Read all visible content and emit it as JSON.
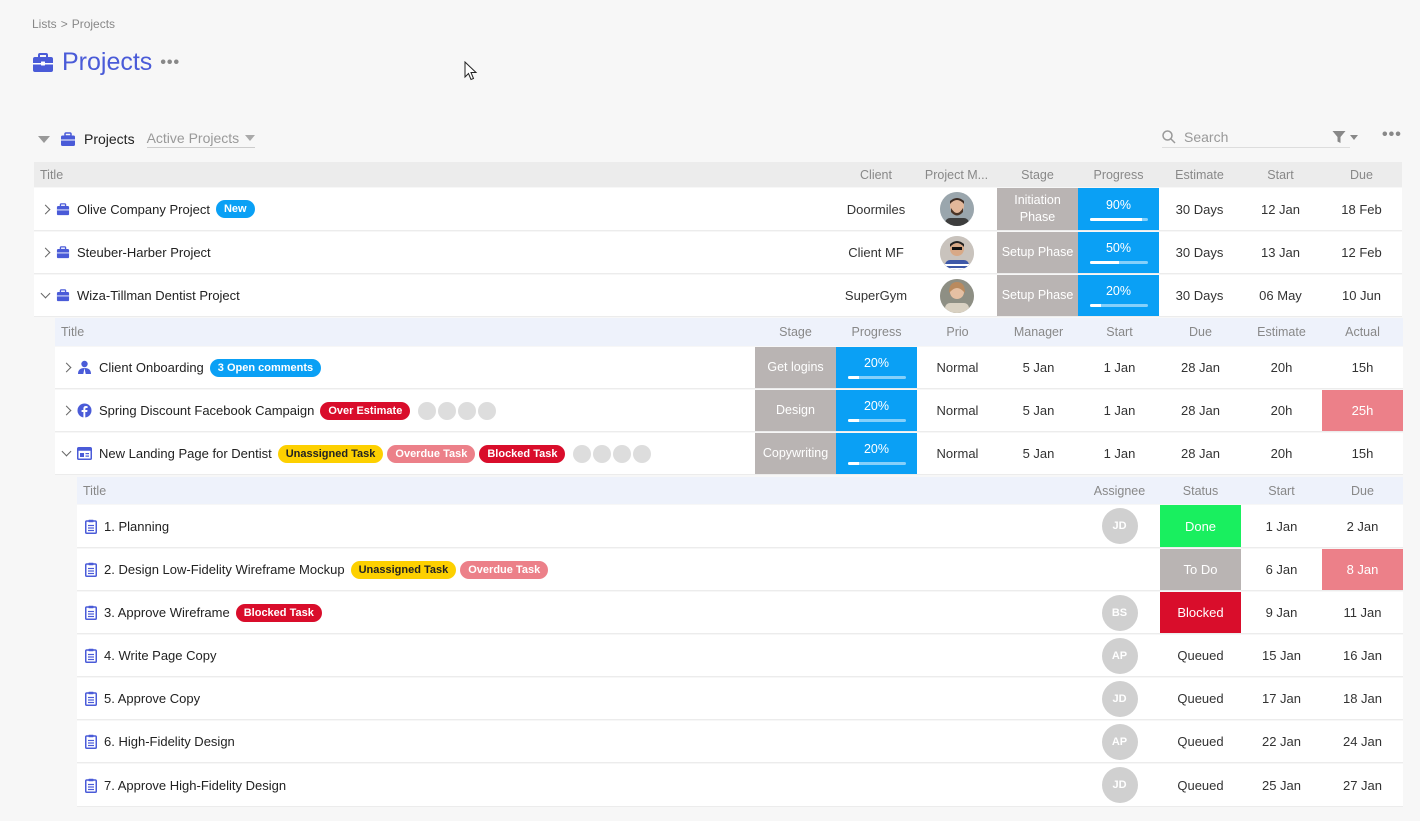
{
  "breadcrumb": {
    "lists": "Lists",
    "sep": ">",
    "current": "Projects"
  },
  "page": {
    "title": "Projects",
    "more": "•••"
  },
  "list": {
    "name": "Projects",
    "view": "Active Projects",
    "search_placeholder": "Search",
    "more": "•••"
  },
  "colors": {
    "accent": "#4a5bd8",
    "progress": "#0aa0f5",
    "stage": "#b9b4b3",
    "done": "#19ef5f",
    "blocked": "#d90d2b",
    "overdue": "#ec8089",
    "badge_new": "#0aa0f5",
    "badge_unassigned": "#fdd000",
    "badge_overdue": "#ec8089",
    "badge_blocked": "#d90d2b",
    "badge_over_estimate": "#d90d2b"
  },
  "icons": {
    "project": "briefcase-icon",
    "onboarding": "person-icon",
    "campaign": "facebook-icon",
    "landing": "window-icon",
    "task": "clipboard-icon",
    "search": "search-icon",
    "filter": "filter-icon"
  },
  "projects_header": {
    "title": "Title",
    "client": "Client",
    "manager": "Project M...",
    "stage": "Stage",
    "progress": "Progress",
    "estimate": "Estimate",
    "start": "Start",
    "due": "Due"
  },
  "projects": [
    {
      "title": "Olive Company Project",
      "badge": "New",
      "client": "Doormiles",
      "stage": "Initiation Phase",
      "progress": "90%",
      "progress_value": 90,
      "estimate": "30 Days",
      "start": "12 Jan",
      "due": "18 Feb"
    },
    {
      "title": "Steuber-Harber Project",
      "client": "Client MF",
      "stage": "Setup Phase",
      "progress": "50%",
      "progress_value": 50,
      "estimate": "30 Days",
      "start": "13 Jan",
      "due": "12 Feb"
    },
    {
      "title": "Wiza-Tillman Dentist Project",
      "client": "SuperGym",
      "stage": "Setup Phase",
      "progress": "20%",
      "progress_value": 20,
      "estimate": "30 Days",
      "start": "06 May",
      "due": "10 Jun"
    }
  ],
  "sub_header": {
    "title": "Title",
    "stage": "Stage",
    "progress": "Progress",
    "prio": "Prio",
    "manager": "Manager",
    "start": "Start",
    "due": "Due",
    "estimate": "Estimate",
    "actual": "Actual"
  },
  "sub_items": [
    {
      "title": "Client Onboarding",
      "badges": [
        "3 Open comments"
      ],
      "stage": "Get logins",
      "progress": "20%",
      "progress_value": 20,
      "prio": "Normal",
      "manager": "5 Jan",
      "start": "1 Jan",
      "due": "28 Jan",
      "estimate": "20h",
      "actual": "15h"
    },
    {
      "title": "Spring Discount Facebook Campaign",
      "badges": [
        "Over Estimate"
      ],
      "stage": "Design",
      "progress": "20%",
      "progress_value": 20,
      "prio": "Normal",
      "manager": "5 Jan",
      "start": "1 Jan",
      "due": "28 Jan",
      "estimate": "20h",
      "actual": "25h"
    },
    {
      "title": "New Landing Page for Dentist",
      "badges": [
        "Unassigned Task",
        "Overdue Task",
        "Blocked Task"
      ],
      "stage": "Copywriting",
      "progress": "20%",
      "progress_value": 20,
      "prio": "Normal",
      "manager": "5 Jan",
      "start": "1 Jan",
      "due": "28 Jan",
      "estimate": "20h",
      "actual": "15h"
    }
  ],
  "task_header": {
    "title": "Title",
    "assignee": "Assignee",
    "status": "Status",
    "start": "Start",
    "due": "Due"
  },
  "tasks": [
    {
      "title": "1. Planning",
      "badges": [],
      "assignee": "JD",
      "status": "Done",
      "start": "1 Jan",
      "due": "2 Jan"
    },
    {
      "title": "2. Design Low-Fidelity Wireframe Mockup",
      "badges": [
        "Unassigned Task",
        "Overdue Task"
      ],
      "assignee": "",
      "status": "To Do",
      "start": "6 Jan",
      "due": "8 Jan"
    },
    {
      "title": "3. Approve Wireframe",
      "badges": [
        "Blocked Task"
      ],
      "assignee": "BS",
      "status": "Blocked",
      "start": "9 Jan",
      "due": "11 Jan"
    },
    {
      "title": "4. Write Page Copy",
      "badges": [],
      "assignee": "AP",
      "status": "Queued",
      "start": "15 Jan",
      "due": "16 Jan"
    },
    {
      "title": "5. Approve Copy",
      "badges": [],
      "assignee": "JD",
      "status": "Queued",
      "start": "17 Jan",
      "due": "18 Jan"
    },
    {
      "title": "6. High-Fidelity Design",
      "badges": [],
      "assignee": "AP",
      "status": "Queued",
      "start": "22 Jan",
      "due": "24 Jan"
    },
    {
      "title": "7. Approve High-Fidelity Design",
      "badges": [],
      "assignee": "JD",
      "status": "Queued",
      "start": "25 Jan",
      "due": "27 Jan"
    }
  ]
}
